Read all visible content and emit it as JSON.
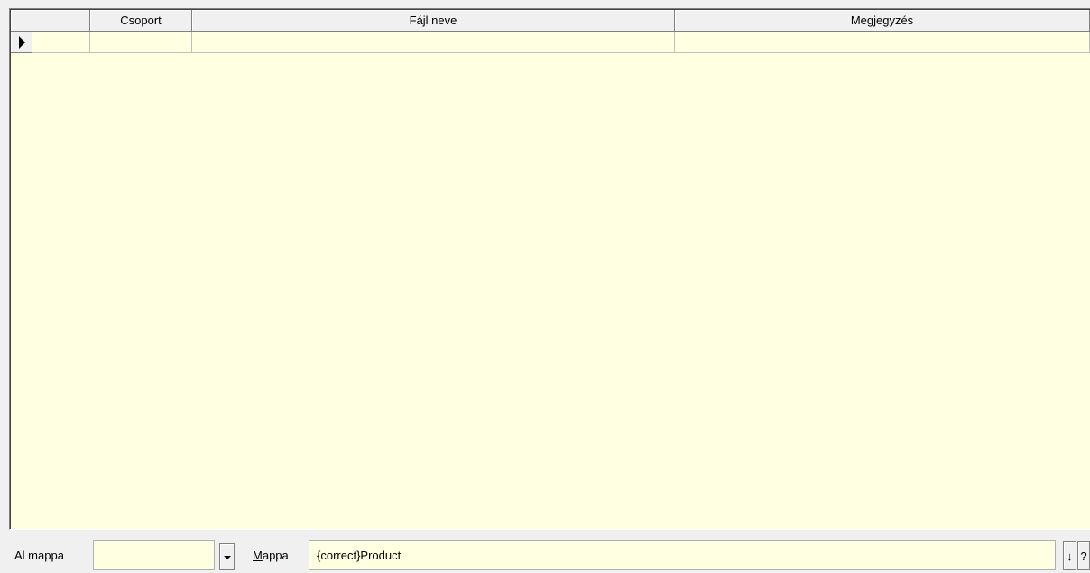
{
  "grid": {
    "columns": [
      {
        "label": ""
      },
      {
        "label": "Csoport"
      },
      {
        "label": "Fájl neve"
      },
      {
        "label": "Megjegyzés"
      }
    ],
    "rows": [
      {
        "csoport": "",
        "fajl_neve": "",
        "megjegyzes": ""
      }
    ],
    "background_color": "#ffffe1"
  },
  "footer": {
    "al_mappa_label": "Al mappa",
    "al_mappa_value": "",
    "mappa_label_accel": "M",
    "mappa_label_rest": "appa",
    "mappa_value": "{correct}Product",
    "down_button_label": "↓",
    "help_button_label": "?"
  }
}
